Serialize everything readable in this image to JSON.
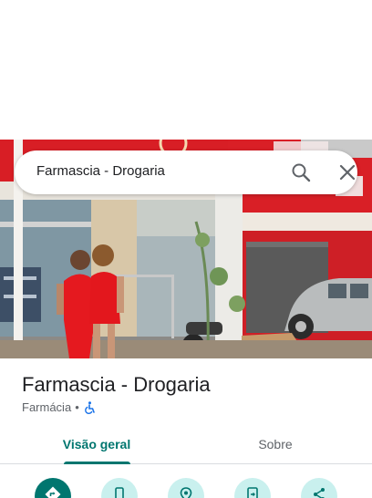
{
  "search": {
    "query": "Farmascia - Drogaria"
  },
  "place": {
    "name": "Farmascia - Drogaria",
    "category": "Farmácia",
    "separator": "•"
  },
  "tabs": [
    {
      "label": "Visão geral",
      "selected": true
    },
    {
      "label": "Sobre",
      "selected": false
    }
  ],
  "actions": [
    {
      "icon": "directions-icon"
    },
    {
      "icon": "phone-icon"
    },
    {
      "icon": "location-pin-icon"
    },
    {
      "icon": "add-to-phone-icon"
    },
    {
      "icon": "share-icon"
    }
  ],
  "colors": {
    "accent": "#00766f",
    "accent_light": "#c9f0ee",
    "storefront_red": "#d91f26",
    "accessibility_blue": "#1a73e8"
  }
}
